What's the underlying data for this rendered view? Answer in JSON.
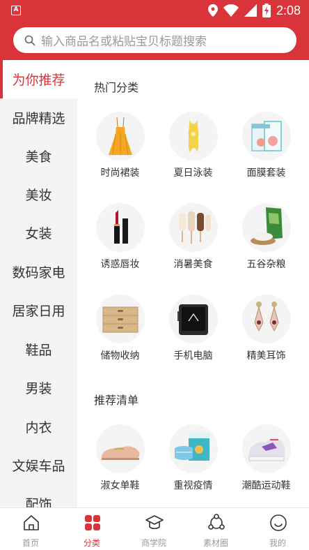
{
  "status_bar": {
    "time": "2:08",
    "app_icon": "A"
  },
  "search": {
    "placeholder": "输入商品名或粘贴宝贝标题搜索"
  },
  "colors": {
    "brand": "#d9343a",
    "sidebar_bg": "#f4f4f4",
    "inactive": "#999999"
  },
  "sidebar": {
    "items": [
      {
        "label": "为你推荐",
        "active": true
      },
      {
        "label": "品牌精选"
      },
      {
        "label": "美食"
      },
      {
        "label": "美妆"
      },
      {
        "label": "女装"
      },
      {
        "label": "数码家电"
      },
      {
        "label": "居家日用"
      },
      {
        "label": "鞋品"
      },
      {
        "label": "男装"
      },
      {
        "label": "内衣"
      },
      {
        "label": "文娱车品"
      },
      {
        "label": "配饰"
      }
    ]
  },
  "hot_categories": {
    "title": "热门分类",
    "items": [
      {
        "label": "时尚裙装",
        "icon": "dress-icon"
      },
      {
        "label": "夏日泳装",
        "icon": "swimsuit-icon"
      },
      {
        "label": "面膜套装",
        "icon": "facemask-icon"
      },
      {
        "label": "诱惑唇妆",
        "icon": "lipstick-icon"
      },
      {
        "label": "消暑美食",
        "icon": "popsicle-icon"
      },
      {
        "label": "五谷杂粮",
        "icon": "rice-icon"
      },
      {
        "label": "储物收纳",
        "icon": "drawer-icon"
      },
      {
        "label": "手机电脑",
        "icon": "phone-icon"
      },
      {
        "label": "精美耳饰",
        "icon": "earring-icon"
      }
    ]
  },
  "recommend": {
    "title": "推荐清单",
    "items": [
      {
        "label": "淑女单鞋",
        "icon": "loafer-icon"
      },
      {
        "label": "重视疫情",
        "icon": "mask-box-icon"
      },
      {
        "label": "潮酷运动鞋",
        "icon": "sneaker-icon"
      }
    ]
  },
  "bottom_nav": {
    "items": [
      {
        "label": "首页",
        "icon": "home-icon"
      },
      {
        "label": "分类",
        "icon": "category-icon",
        "active": true
      },
      {
        "label": "商学院",
        "icon": "graduation-cap-icon"
      },
      {
        "label": "素材圈",
        "icon": "share-circle-icon"
      },
      {
        "label": "我的",
        "icon": "smile-face-icon"
      }
    ]
  }
}
